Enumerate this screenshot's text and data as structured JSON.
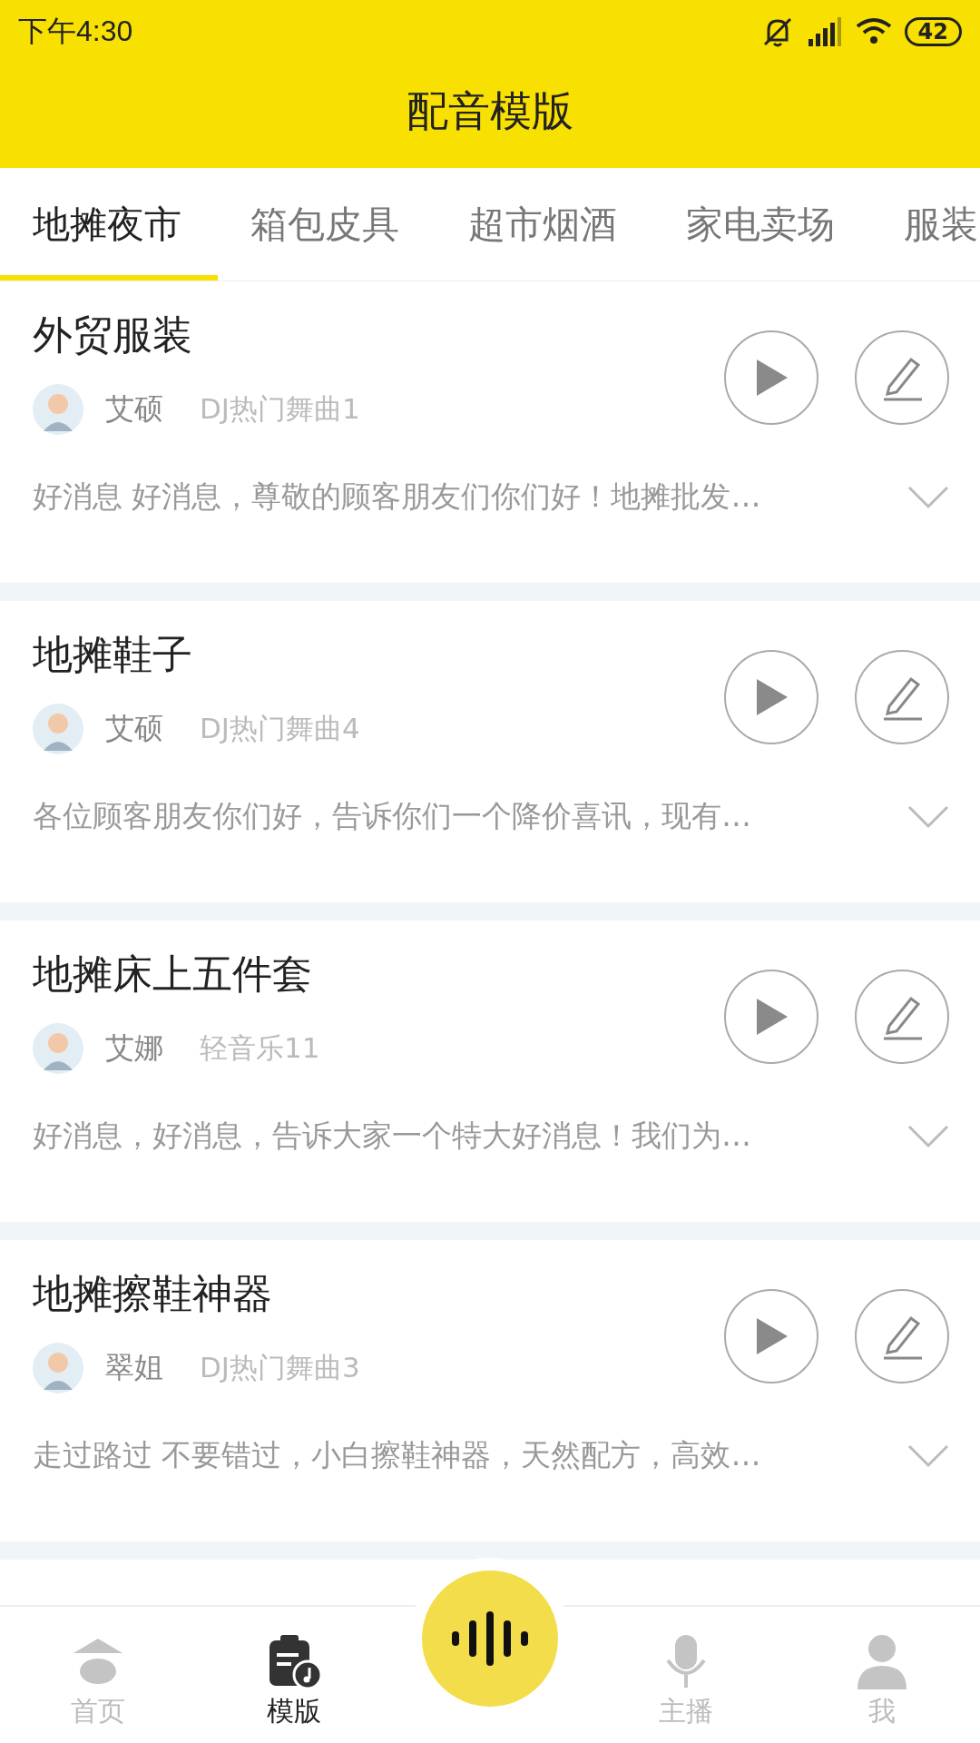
{
  "status_bar": {
    "time": "下午4:30",
    "battery": "42"
  },
  "header": {
    "title": "配音模版"
  },
  "tabs": [
    {
      "label": "地摊夜市",
      "selected": true
    },
    {
      "label": "箱包皮具",
      "selected": false
    },
    {
      "label": "超市烟酒",
      "selected": false
    },
    {
      "label": "家电卖场",
      "selected": false
    },
    {
      "label": "服装",
      "selected": false
    }
  ],
  "templates": [
    {
      "title": "外贸服装",
      "voice": "艾硕",
      "music": "DJ热门舞曲1",
      "text": "好消息 好消息，尊敬的顾客朋友们你们好！地摊批发…"
    },
    {
      "title": "地摊鞋子",
      "voice": "艾硕",
      "music": "DJ热门舞曲4",
      "text": "各位顾客朋友你们好，告诉你们一个降价喜讯，现有…"
    },
    {
      "title": "地摊床上五件套",
      "voice": "艾娜",
      "music": "轻音乐11",
      "text": "好消息，好消息，告诉大家一个特大好消息！我们为…"
    },
    {
      "title": "地摊擦鞋神器",
      "voice": "翠姐",
      "music": "DJ热门舞曲3",
      "text": "走过路过 不要错过，小白擦鞋神器，天然配方，高效…"
    }
  ],
  "bottom_nav": [
    {
      "kind": "home",
      "label": "首页",
      "selected": false
    },
    {
      "kind": "template",
      "label": "模版",
      "selected": true
    },
    {
      "kind": "record",
      "selected": false
    },
    {
      "kind": "anchor",
      "label": "主播",
      "selected": false
    },
    {
      "kind": "me",
      "label": "我",
      "selected": false
    }
  ]
}
